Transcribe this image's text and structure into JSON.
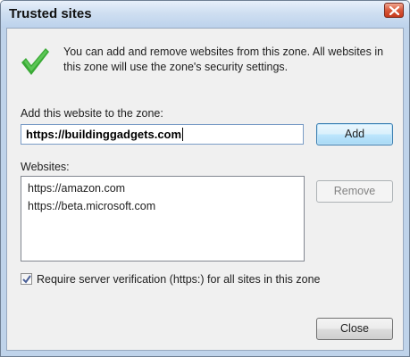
{
  "window": {
    "title": "Trusted sites"
  },
  "info_text": "You can add and remove websites from this zone. All websites in this zone will use the zone's security settings.",
  "add_section": {
    "label": "Add this website to the zone:",
    "input_value": "https://buildinggadgets.com",
    "add_button": "Add"
  },
  "websites": {
    "label": "Websites:",
    "items": [
      "https://amazon.com",
      "https://beta.microsoft.com"
    ],
    "remove_button": "Remove"
  },
  "require_verification": {
    "checked": true,
    "label": "Require server verification (https:) for all sites in this zone"
  },
  "close_button": "Close",
  "colors": {
    "check_icon": "#39a935",
    "default_button_border": "#3c7fb1",
    "close_x_button": "#c5391c"
  },
  "icons": {
    "status": "checkmark-icon",
    "window_close": "close-icon",
    "checkbox": "checkmark-icon"
  }
}
